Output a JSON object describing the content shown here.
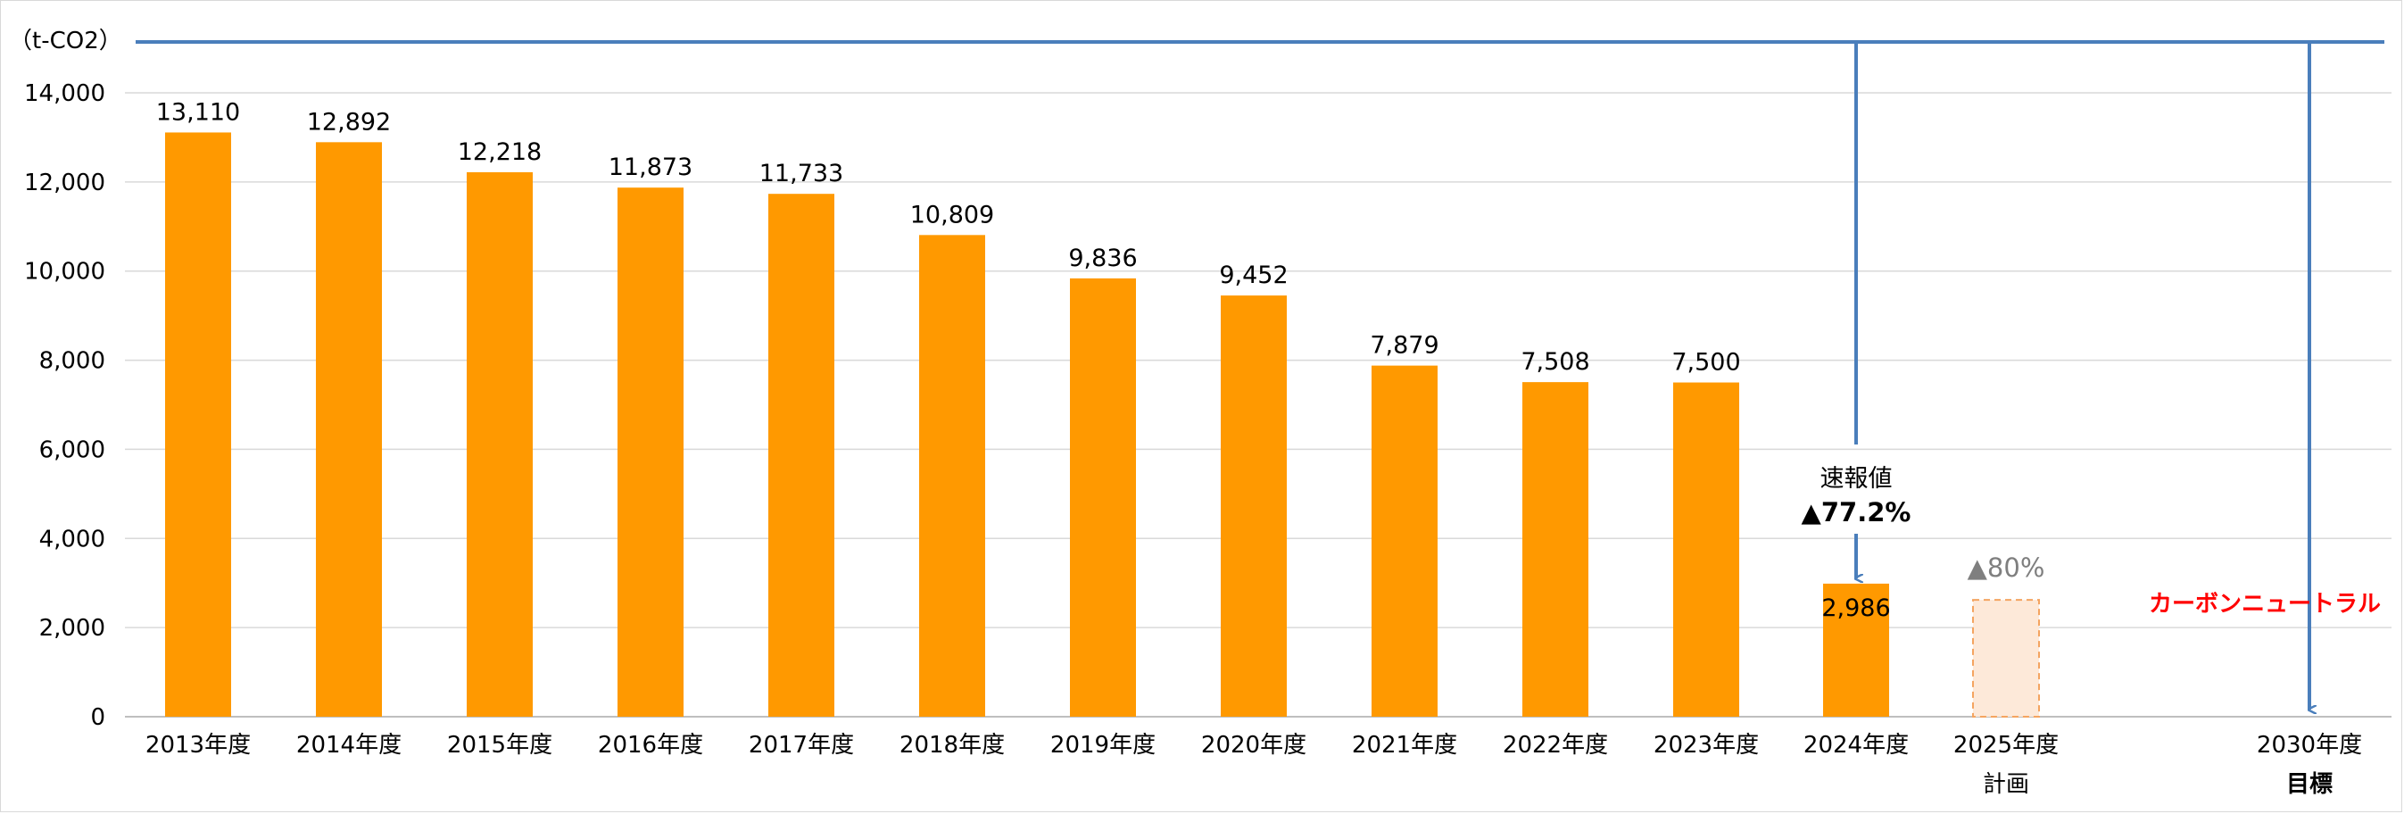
{
  "chart_data": {
    "type": "bar",
    "unit_label": "（t-CO2）",
    "ylim": [
      0,
      14000
    ],
    "yticks": [
      0,
      2000,
      4000,
      6000,
      8000,
      10000,
      12000,
      14000
    ],
    "ytick_labels": [
      "0",
      "2,000",
      "4,000",
      "6,000",
      "8,000",
      "10,000",
      "12,000",
      "14,000"
    ],
    "grid": true,
    "categories": [
      "2013年度",
      "2014年度",
      "2015年度",
      "2016年度",
      "2017年度",
      "2018年度",
      "2019年度",
      "2020年度",
      "2021年度",
      "2022年度",
      "2023年度",
      "2024年度",
      "2025年度",
      "2030年度"
    ],
    "category_sublabels": [
      "",
      "",
      "",
      "",
      "",
      "",
      "",
      "",
      "",
      "",
      "",
      "",
      "計画",
      "目標"
    ],
    "values": [
      13110,
      12892,
      12218,
      11873,
      11733,
      10809,
      9836,
      9452,
      7879,
      7508,
      7500,
      2986,
      2622,
      0
    ],
    "data_labels": [
      "13,110",
      "12,892",
      "12,218",
      "11,873",
      "11,733",
      "10,809",
      "9,836",
      "9,452",
      "7,879",
      "7,508",
      "7,500",
      "2,986",
      "",
      ""
    ],
    "bar_styles": [
      "solid",
      "solid",
      "solid",
      "solid",
      "solid",
      "solid",
      "solid",
      "solid",
      "solid",
      "solid",
      "solid",
      "solid",
      "dashed",
      "none"
    ],
    "annotations": {
      "preliminary_label": "速報値",
      "preliminary_reduction": "▲77.2%",
      "plan_reduction": "▲80%",
      "target_text": "カーボンニュートラル"
    },
    "colors": {
      "bar": "#ff9900",
      "plan_fill": "#fde9d9",
      "plan_border": "#f4a460",
      "arrow": "#4a7ebb",
      "grid": "#d9d9d9",
      "target_red": "#ff0000",
      "muted": "#7f7f7f"
    }
  }
}
